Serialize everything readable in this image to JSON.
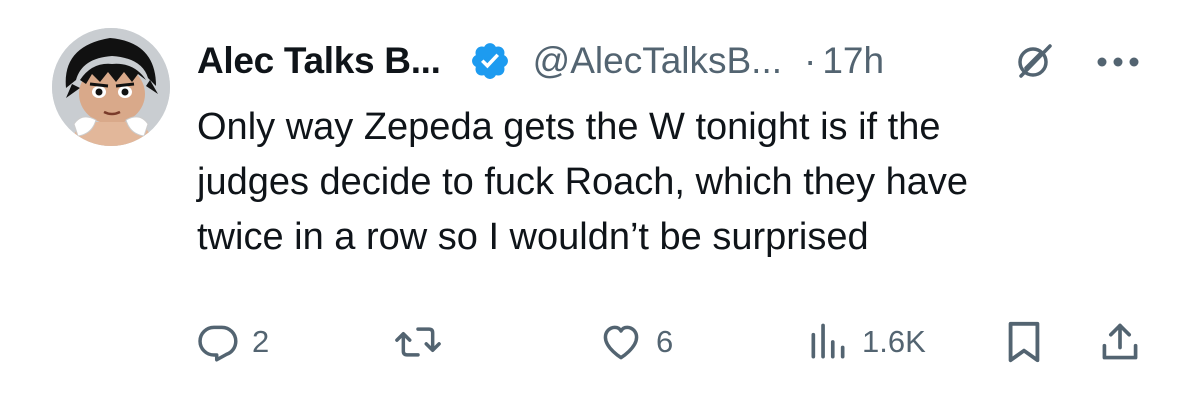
{
  "tweet": {
    "display_name": "Alec Talks B...",
    "handle": "@AlecTalksB...",
    "separator": "·",
    "time": "17h",
    "text_lines": [
      "Only way Zepeda gets the W tonight is if the",
      "judges decide to fuck Roach, which they have",
      "twice in a row so I wouldn’t be surprised"
    ]
  },
  "actions": {
    "replies": {
      "icon": "reply-icon",
      "count": "2"
    },
    "reposts": {
      "icon": "repost-icon",
      "count": ""
    },
    "likes": {
      "icon": "heart-icon",
      "count": "6"
    },
    "views": {
      "icon": "views-icon",
      "count": "1.6K"
    },
    "bookmark": {
      "icon": "bookmark-icon"
    },
    "share": {
      "icon": "share-icon"
    }
  },
  "colors": {
    "text": "#0f1419",
    "secondary": "#536471",
    "verified": "#1d9bf0",
    "background": "#ffffff"
  }
}
